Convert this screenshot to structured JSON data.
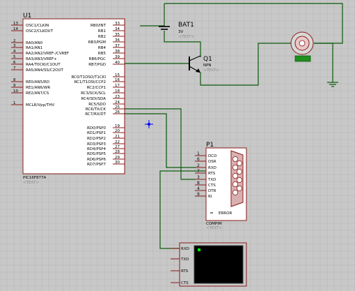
{
  "colors": {
    "background": "#c8c8c8",
    "grid": "#b4b4b4",
    "wire": "#0b5a0b",
    "body": "#ffffff",
    "outline": "#8a1a1a",
    "pin": "#8a1a1a",
    "text": "#000000",
    "placeholder": "#8c8c8c",
    "motor_tag": "#1f8f1f",
    "screen": "#000000",
    "screen_dot": "#00ff00",
    "probe": "#0000ff"
  },
  "mcu": {
    "ref": "U1",
    "part": "PIC16F877A",
    "text_tag": "<TEXT>",
    "left_pins": [
      {
        "num": "13",
        "label": "OSC1/CLKIN"
      },
      {
        "num": "14",
        "label": "OSC2/CLKOUT"
      },
      {
        "num": "2",
        "label": "RA0/AN0"
      },
      {
        "num": "3",
        "label": "RA1/AN1"
      },
      {
        "num": "4",
        "label": "RA2/AN2/VREF-/CVREF"
      },
      {
        "num": "5",
        "label": "RA3/AN3/VREF+"
      },
      {
        "num": "6",
        "label": "RA4/T0CKI/C1OUT"
      },
      {
        "num": "7",
        "label": "RA5/AN4/SS/C2OUT"
      },
      {
        "num": "8",
        "label": "RE0/AN5/RD"
      },
      {
        "num": "9",
        "label": "RE1/AN6/WR"
      },
      {
        "num": "10",
        "label": "RE2/AN7/CS"
      },
      {
        "num": "1",
        "label": "MCLR/Vpp/THV"
      }
    ],
    "right_pins": [
      {
        "num": "33",
        "label": "RB0/INT"
      },
      {
        "num": "34",
        "label": "RB1"
      },
      {
        "num": "35",
        "label": "RB2"
      },
      {
        "num": "36",
        "label": "RB3/PGM"
      },
      {
        "num": "37",
        "label": "RB4"
      },
      {
        "num": "38",
        "label": "RB5"
      },
      {
        "num": "39",
        "label": "RB6/PGC"
      },
      {
        "num": "40",
        "label": "RB7/PGD"
      },
      {
        "num": "15",
        "label": "RC0/T1OSO/T1CKI"
      },
      {
        "num": "16",
        "label": "RC1/T1OSI/CCP2"
      },
      {
        "num": "17",
        "label": "RC2/CCP1"
      },
      {
        "num": "18",
        "label": "RC3/SCK/SCL"
      },
      {
        "num": "23",
        "label": "RC4/SDI/SDA"
      },
      {
        "num": "24",
        "label": "RC5/SDO"
      },
      {
        "num": "25",
        "label": "RC6/TX/CK"
      },
      {
        "num": "26",
        "label": "RC7/RX/DT"
      },
      {
        "num": "19",
        "label": "RD0/PSP0"
      },
      {
        "num": "20",
        "label": "RD1/PSP1"
      },
      {
        "num": "21",
        "label": "RD2/PSP2"
      },
      {
        "num": "22",
        "label": "RD3/PSP3"
      },
      {
        "num": "27",
        "label": "RD4/PSP4"
      },
      {
        "num": "28",
        "label": "RD5/PSP5"
      },
      {
        "num": "29",
        "label": "RD6/PSP6"
      },
      {
        "num": "30",
        "label": "RD7/PSP7"
      }
    ]
  },
  "battery": {
    "ref": "BAT1",
    "value": "3V",
    "text_tag": "<TEXT>"
  },
  "transistor": {
    "ref": "Q1",
    "type": "NPN",
    "text_tag": "<TEXT>"
  },
  "connector": {
    "ref": "P1",
    "part": "COMPIM",
    "text_tag": "<TEXT>",
    "pins": [
      {
        "num": "1",
        "label": "DCD"
      },
      {
        "num": "6",
        "label": "DSR"
      },
      {
        "num": "2",
        "label": "RXD"
      },
      {
        "num": "7",
        "label": "RTS"
      },
      {
        "num": "3",
        "label": "TXD"
      },
      {
        "num": "8",
        "label": "CTS"
      },
      {
        "num": "4",
        "label": "DTR"
      },
      {
        "num": "9",
        "label": "RI"
      }
    ],
    "error_label": "ERROR"
  },
  "terminal": {
    "pins": [
      "RXD",
      "TXD",
      "RTS",
      "CTS"
    ]
  }
}
